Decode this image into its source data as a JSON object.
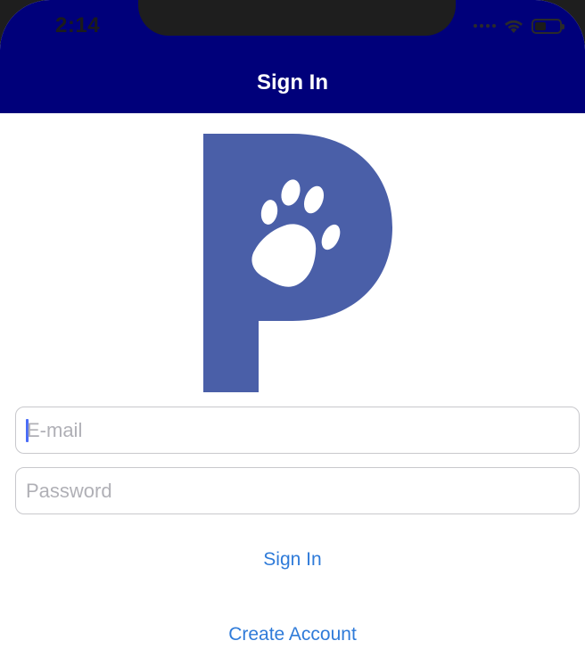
{
  "status_bar": {
    "time": "2:14"
  },
  "nav_bar": {
    "title": "Sign In",
    "background_color": "#00007a"
  },
  "logo": {
    "icon": "paw-print-p-logo-icon",
    "color": "#4a5fa8"
  },
  "form": {
    "email_placeholder": "E-mail",
    "password_placeholder": "Password"
  },
  "actions": {
    "sign_in_label": "Sign In",
    "create_account_label": "Create Account",
    "link_color": "#2f7bd9"
  }
}
